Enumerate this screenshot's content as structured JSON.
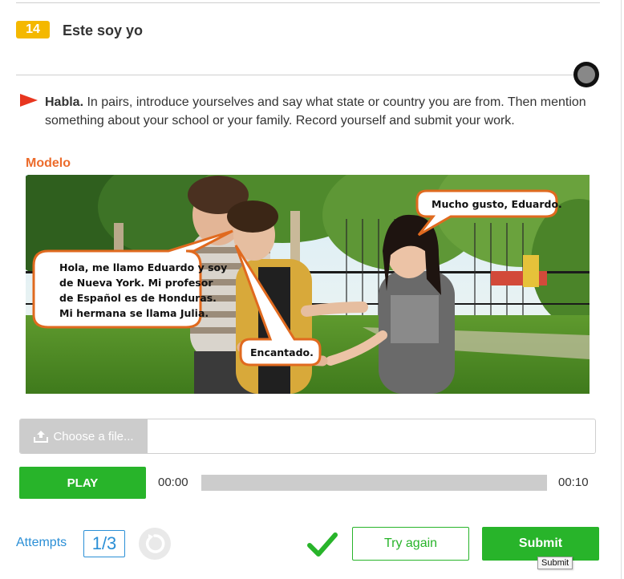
{
  "activity": {
    "number": "14",
    "title": "Este soy yo"
  },
  "instructions": {
    "bold_lead": "Habla.",
    "text": " In pairs, introduce yourselves and say what state or country you are from. Then mention something about your school or your family. Record yourself and submit your work."
  },
  "model": {
    "label": "Modelo",
    "bubbles": {
      "eduardo_lines": [
        "Hola, me llamo Eduardo y soy",
        "de Nueva York. Mi profesor",
        "de Español es de Honduras.",
        "Mi hermana se llama Julia."
      ],
      "girl": "Mucho gusto, Eduardo.",
      "boy2": "Encantado."
    }
  },
  "file_upload": {
    "button_label": "Choose a file...",
    "file_name": ""
  },
  "player": {
    "play_label": "PLAY",
    "time_start": "00:00",
    "time_end": "00:10",
    "progress": 0
  },
  "footer": {
    "attempts_label": "Attempts",
    "attempts_value": "1/3",
    "try_again_label": "Try again",
    "submit_label": "Submit",
    "submit_tooltip": "Submit"
  },
  "colors": {
    "badge": "#f4b800",
    "accent_orange": "#ec6b2b",
    "green": "#28b42a",
    "blue": "#2b8fd6",
    "flag_red": "#e8361f"
  },
  "icons": [
    "record-icon",
    "flag-icon",
    "upload-icon",
    "reset-icon",
    "check-icon"
  ]
}
